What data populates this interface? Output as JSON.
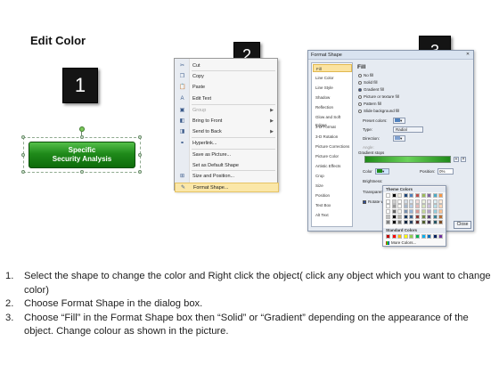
{
  "title": "Edit Color",
  "step_badges": [
    "1",
    "2",
    "3"
  ],
  "shape": {
    "line1": "Specific",
    "line2": "Security Analysis",
    "fill_color": "#1f8a1a"
  },
  "context_menu": {
    "items": [
      {
        "label": "Cut",
        "icon": "scissors-icon",
        "glyph": "✂"
      },
      {
        "label": "Copy",
        "icon": "copy-icon",
        "glyph": "❐"
      },
      {
        "label": "Paste",
        "icon": "paste-icon",
        "glyph": "📋"
      },
      {
        "label": "Edit Text",
        "icon": "edit-text-icon",
        "glyph": "A"
      },
      {
        "label": "Group",
        "icon": "group-icon",
        "glyph": "▣",
        "disabled": true,
        "submenu": true
      },
      {
        "label": "Bring to Front",
        "icon": "bring-front-icon",
        "glyph": "◧",
        "submenu": true
      },
      {
        "label": "Send to Back",
        "icon": "send-back-icon",
        "glyph": "◨",
        "submenu": true
      },
      {
        "label": "Hyperlink...",
        "icon": "hyperlink-icon",
        "glyph": "⚭"
      },
      {
        "label": "Save as Picture...",
        "icon": "",
        "glyph": ""
      },
      {
        "label": "Set as Default Shape",
        "icon": "",
        "glyph": ""
      },
      {
        "label": "Size and Position...",
        "icon": "size-icon",
        "glyph": "⊞"
      },
      {
        "label": "Format Shape...",
        "icon": "format-shape-icon",
        "glyph": "✎",
        "highlight": true
      }
    ]
  },
  "dialog": {
    "title": "Format Shape",
    "close": "✕",
    "categories": [
      "Fill",
      "Line Color",
      "Line Style",
      "Shadow",
      "Reflection",
      "Glow and Soft Edges",
      "3-D Format",
      "3-D Rotation",
      "Picture Corrections",
      "Picture Color",
      "Artistic Effects",
      "Crop",
      "Size",
      "Position",
      "Text Box",
      "Alt Text"
    ],
    "section": "Fill",
    "fill_options": [
      "No fill",
      "Solid fill",
      "Gradient fill",
      "Picture or texture fill",
      "Pattern fill",
      "Slide background fill"
    ],
    "selected_fill": "Gradient fill",
    "preset_colors_label": "Preset colors:",
    "type_label": "Type:",
    "type_value": "Radial",
    "direction_label": "Direction:",
    "angle_label": "Angle:",
    "gradient_stops_label": "Gradient stops",
    "color_label": "Color",
    "position_label": "Position:",
    "position_value": "0%",
    "brightness_label": "Brightness:",
    "transparency_label": "Transparency:",
    "rotate_label": "Rotate with shape",
    "close_button": "Close"
  },
  "palette": {
    "theme_label": "Theme Colors",
    "standard_label": "Standard Colors",
    "more_label": "More Colors...",
    "theme_top": [
      "#ffffff",
      "#000000",
      "#eeece1",
      "#1f497d",
      "#4f81bd",
      "#c0504d",
      "#9bbb59",
      "#8064a2",
      "#4bacc6",
      "#f79646"
    ],
    "standard": [
      "#c00000",
      "#ff0000",
      "#ffc000",
      "#ffff00",
      "#92d050",
      "#00b050",
      "#00b0f0",
      "#0070c0",
      "#002060",
      "#7030a0"
    ]
  },
  "instructions": [
    {
      "num": "1.",
      "text": "Select the shape to change the color and Right click the object( click any object which you want to change color)"
    },
    {
      "num": "2.",
      "text": "Choose Format Shape in the dialog box."
    },
    {
      "num": "3.",
      "text": "Choose “Fill” in the Format Shape box then “Solid” or “Gradient” depending on the appearance of the object. Change colour as shown in the picture."
    }
  ]
}
